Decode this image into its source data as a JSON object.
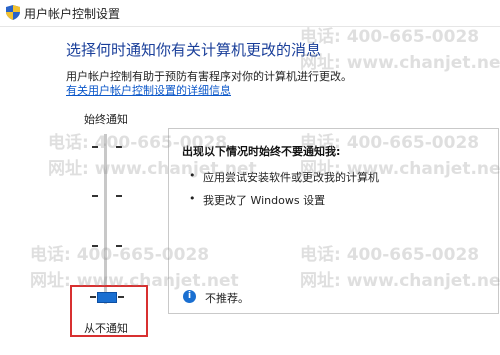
{
  "window": {
    "title": "用户帐户控制设置"
  },
  "main": {
    "heading": "选择何时通知你有关计算机更改的消息",
    "description": "用户帐户控制有助于预防有害程序对你的计算机进行更改。",
    "link": "有关用户帐户控制设置的详细信息"
  },
  "slider": {
    "top_label": "始终通知",
    "bottom_label": "从不通知",
    "levels": 4,
    "selected_level": 1
  },
  "panel": {
    "title": "出现以下情况时始终不要通知我:",
    "bullets": [
      "应用尝试安装软件或更改我的计算机",
      "我更改了 Windows 设置"
    ],
    "recommendation": "不推荐。"
  },
  "watermark": {
    "line1": "电话: 400-665-0028",
    "line2": "网址: www.chanjet.net"
  },
  "colors": {
    "heading": "#1a3f9a",
    "link": "#0b57c9",
    "accent": "#1a6fd1",
    "highlight": "#d83030"
  }
}
